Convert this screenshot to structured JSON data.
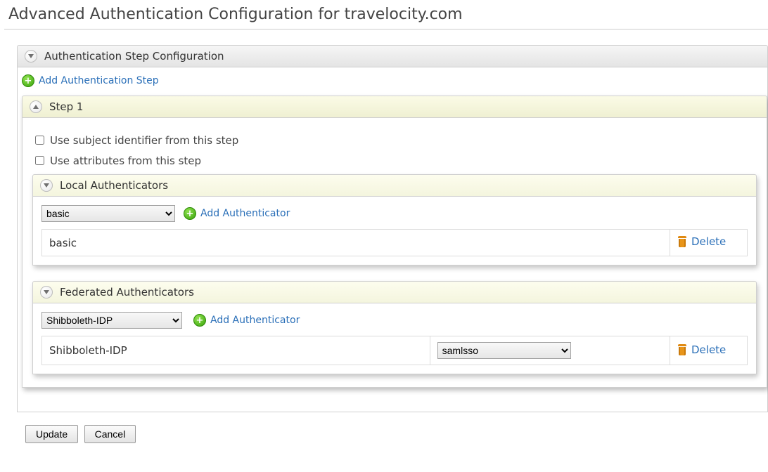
{
  "page_title": "Advanced Authentication Configuration for travelocity.com",
  "outer_section_title": "Authentication Step Configuration",
  "add_step_label": "Add Authentication Step",
  "step": {
    "title": "Step 1",
    "use_subject_label": "Use subject identifier from this step",
    "use_subject_checked": false,
    "use_attributes_label": "Use attributes from this step",
    "use_attributes_checked": false
  },
  "local": {
    "title": "Local Authenticators",
    "selected": "basic",
    "options": [
      "basic"
    ],
    "add_label": "Add Authenticator",
    "rows": [
      {
        "name": "basic"
      }
    ]
  },
  "federated": {
    "title": "Federated Authenticators",
    "selected": "Shibboleth-IDP",
    "options": [
      "Shibboleth-IDP"
    ],
    "add_label": "Add Authenticator",
    "rows": [
      {
        "name": "Shibboleth-IDP",
        "auth_selected": "samlsso",
        "auth_options": [
          "samlsso"
        ]
      }
    ]
  },
  "delete_label": "Delete",
  "buttons": {
    "update": "Update",
    "cancel": "Cancel"
  }
}
